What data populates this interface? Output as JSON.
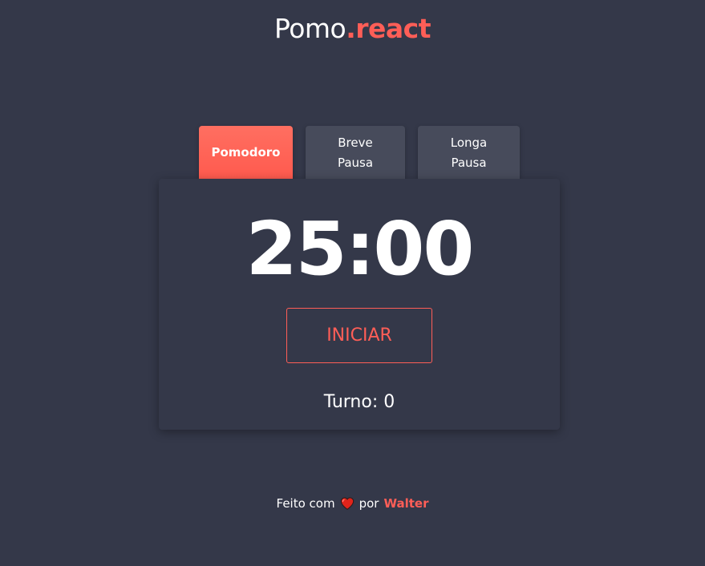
{
  "app": {
    "title_prefix": "Pomo",
    "title_accent": ".react"
  },
  "tabs": [
    {
      "line1": "Pomodoro",
      "line2": "",
      "active": true
    },
    {
      "line1": "Breve",
      "line2": "Pausa",
      "active": false
    },
    {
      "line1": "Longa",
      "line2": "Pausa",
      "active": false
    }
  ],
  "timer": {
    "display": "25:00"
  },
  "controls": {
    "start_label": "INICIAR"
  },
  "turn": {
    "label": "Turno: 0"
  },
  "footer": {
    "made_with": "Feito com",
    "by": "por",
    "author": "Walter",
    "heart_icon": "heart-icon"
  },
  "colors": {
    "background": "#343849",
    "accent": "#ff5e57",
    "tab_active_top": "#ff6f61",
    "tab_active_bottom": "#ff5a4e",
    "tab_inactive": "#474b5b",
    "text": "#ffffff",
    "heart": "#e0241b"
  }
}
